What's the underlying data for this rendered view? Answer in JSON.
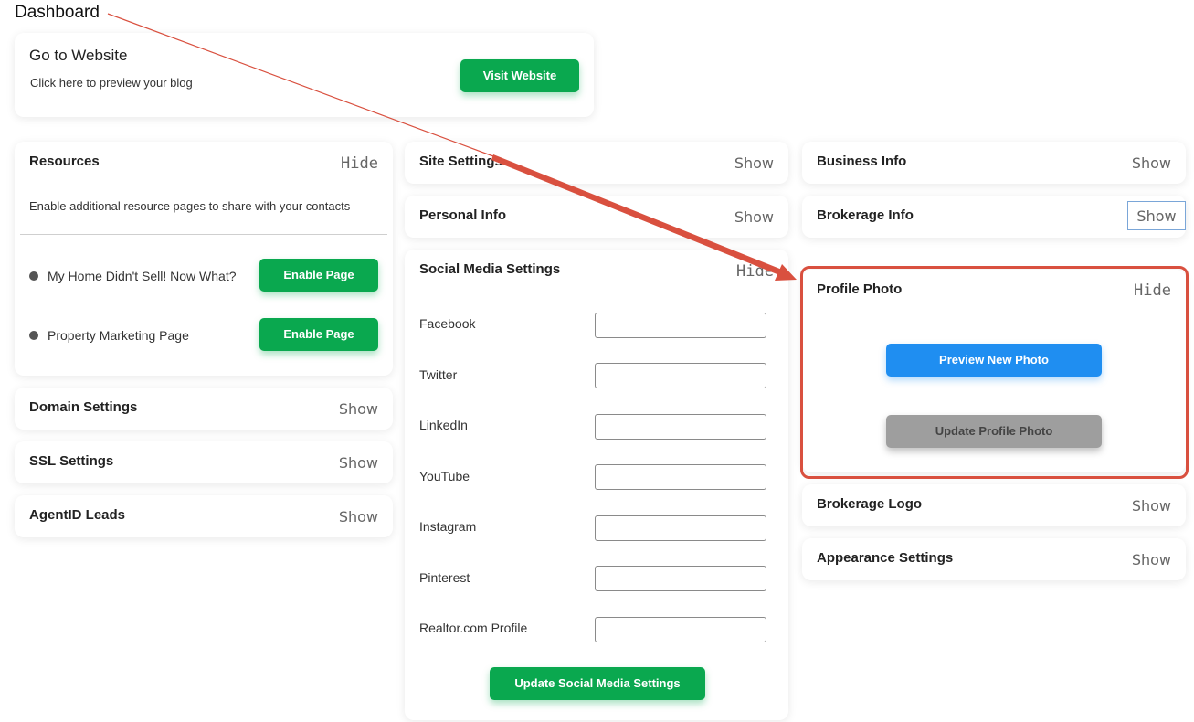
{
  "header": {
    "title": "Dashboard"
  },
  "website_card": {
    "title": "Go to Website",
    "subtitle": "Click here to preview your blog",
    "button_label": "Visit Website"
  },
  "resources": {
    "title": "Resources",
    "toggle": "Hide",
    "description": "Enable additional resource pages to share with your contacts",
    "items": [
      {
        "label": "My Home Didn't Sell! Now What?",
        "button": "Enable Page"
      },
      {
        "label": "Property Marketing Page",
        "button": "Enable Page"
      }
    ]
  },
  "left_collapsed": [
    {
      "title": "Domain Settings",
      "toggle": "Show"
    },
    {
      "title": "SSL Settings",
      "toggle": "Show"
    },
    {
      "title": "AgentID Leads",
      "toggle": "Show"
    }
  ],
  "middle_collapsed": [
    {
      "title": "Site Settings",
      "toggle": "Show"
    },
    {
      "title": "Personal Info",
      "toggle": "Show"
    }
  ],
  "social": {
    "title": "Social Media Settings",
    "toggle": "Hide",
    "fields": [
      {
        "label": "Facebook",
        "value": ""
      },
      {
        "label": "Twitter",
        "value": ""
      },
      {
        "label": "LinkedIn",
        "value": ""
      },
      {
        "label": "YouTube",
        "value": ""
      },
      {
        "label": "Instagram",
        "value": ""
      },
      {
        "label": "Pinterest",
        "value": ""
      },
      {
        "label": "Realtor.com Profile",
        "value": ""
      }
    ],
    "button_label": "Update Social Media Settings"
  },
  "right_collapsed_top": [
    {
      "title": "Business Info",
      "toggle": "Show"
    },
    {
      "title": "Brokerage Info",
      "toggle": "Show"
    }
  ],
  "profile_photo": {
    "title": "Profile Photo",
    "toggle": "Hide",
    "preview_button": "Preview New Photo",
    "update_button": "Update Profile Photo"
  },
  "right_collapsed_bottom": [
    {
      "title": "Brokerage Logo",
      "toggle": "Show"
    },
    {
      "title": "Appearance Settings",
      "toggle": "Show"
    }
  ],
  "colors": {
    "green": "#0aa84f",
    "blue": "#1f8ef1",
    "gray_button": "#9e9e9e",
    "annotation_red": "#d9503f"
  }
}
